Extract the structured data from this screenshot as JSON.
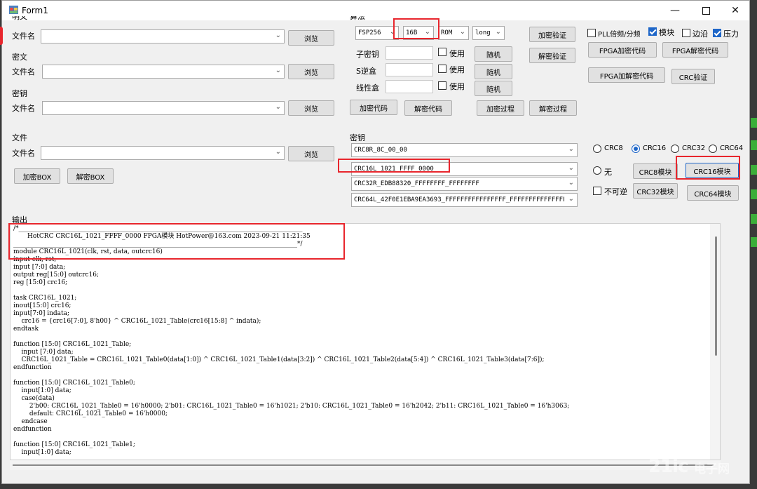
{
  "window": {
    "title": "Form1"
  },
  "files": {
    "plain_label": "明文",
    "cipher_label": "密文",
    "key_label": "密钥",
    "file_group_label": "文件",
    "filename_label": "文件名",
    "browse": "浏览",
    "encrypt_box": "加密BOX",
    "decrypt_box": "解密BOX"
  },
  "algo": {
    "group_label": "算法",
    "algo_select": "FSP256",
    "size_select": "16B",
    "mem_select": "ROM",
    "type_select": "long",
    "subkey_label": "子密钥",
    "sbox_label": "S逆盒",
    "linear_label": "线性盒",
    "use_label": "使用",
    "random_label": "随机",
    "encrypt_code": "加密代码",
    "decrypt_code": "解密代码",
    "encrypt_process": "加密过程",
    "decrypt_process": "解密过程",
    "encrypt_verify": "加密验证",
    "decrypt_verify": "解密验证"
  },
  "options": {
    "pll": "PLL倍频/分频",
    "pll_checked": false,
    "module": "模块",
    "module_checked": true,
    "edge": "边沿",
    "edge_checked": false,
    "pressure": "压力",
    "pressure_checked": true,
    "fpga_encrypt": "FPGA加密代码",
    "fpga_decrypt": "FPGA解密代码",
    "fpga_encdec": "FPGA加解密代码",
    "crc_verify": "CRC验证"
  },
  "keys": {
    "group_label": "密钥",
    "crc8": "CRC8R_8C_00_00",
    "crc16": "CRC16L_1021_FFFF_0000",
    "crc32": "CRC32R_EDB88320_FFFFFFFF_FFFFFFFF",
    "crc64": "CRC64L_42F0E1EBA9EA3693_FFFFFFFFFFFFFFFF_FFFFFFFFFFFFFFFF"
  },
  "crc": {
    "radios": [
      "CRC8",
      "CRC16",
      "CRC32",
      "CRC64"
    ],
    "selected": "CRC16",
    "none_label": "无",
    "irreversible_label": "不可逆",
    "crc8_module": "CRC8模块",
    "crc16_module": "CRC16模块",
    "crc32_module": "CRC32模块",
    "crc64_module": "CRC64模块"
  },
  "output": {
    "label": "输出",
    "text": "/*__________________________________________________________________________________________\n       HotCRC CRC16L_1021_FFFF_0000 FPGA模块 HotPower@163.com 2023-09-21 11:21:35\n__________________________________________________________________________________________*/\nmodule CRC16L_1021(clk, rst, data, outcrc16)\ninput clk, rst;\ninput [7:0] data;\noutput reg[15:0] outcrc16;\nreg [15:0] crc16;\n\ntask CRC16L_1021;\ninout[15:0] crc16;\ninput[7:0] indata;\n    crc16 = {crc16[7:0], 8'h00} ^ CRC16L_1021_Table(crc16[15:8] ^ indata);\nendtask\n\nfunction [15:0] CRC16L_1021_Table;\n    input [7:0] data;\n    CRC16L_1021_Table = CRC16L_1021_Table0(data[1:0]) ^ CRC16L_1021_Table1(data[3:2]) ^ CRC16L_1021_Table2(data[5:4]) ^ CRC16L_1021_Table3(data[7:6]);\nendfunction\n\nfunction [15:0] CRC16L_1021_Table0;\n    input[1:0] data;\n    case(data)\n        2'b00: CRC16L_1021_Table0 = 16'h0000; 2'b01: CRC16L_1021_Table0 = 16'h1021; 2'b10: CRC16L_1021_Table0 = 16'h2042; 2'b11: CRC16L_1021_Table0 = 16'h3063;\n        default: CRC16L_1021_Table0 = 16'h0000;\n    endcase\nendfunction\n\nfunction [15:0] CRC16L_1021_Table1;\n    input[1:0] data;"
  },
  "watermark": {
    "logo": "21ic",
    "sub": "电子网"
  },
  "colors": {
    "highlight": "#e8262d",
    "accent": "#1e66c8"
  }
}
